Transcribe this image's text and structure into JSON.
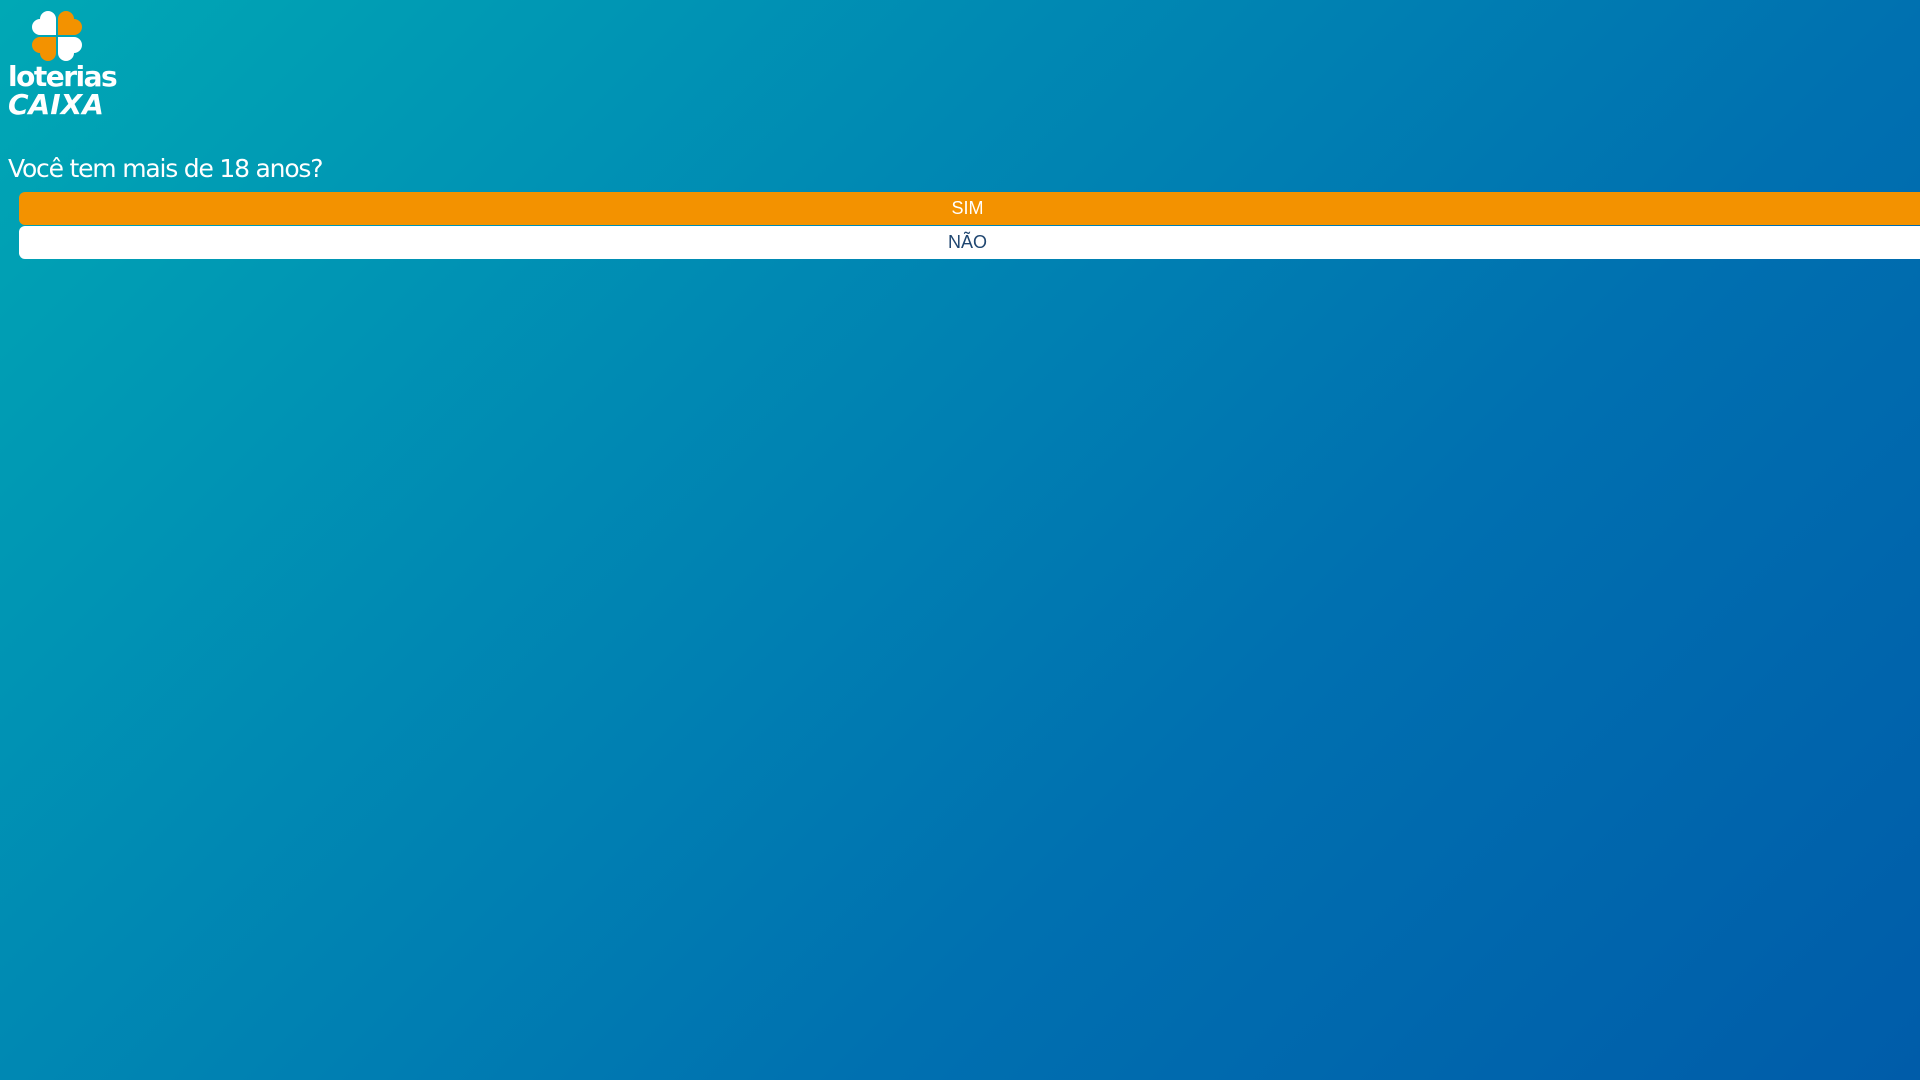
{
  "logo": {
    "line1": "loterias",
    "line2": "CAIXA",
    "colors": {
      "orange": "#f39200",
      "white": "#ffffff"
    }
  },
  "question": "Você tem mais de 18 anos?",
  "buttons": {
    "yes_label": "SIM",
    "no_label": "NÃO"
  },
  "colors": {
    "background_start": "#00a8b5",
    "background_end": "#005ca9",
    "accent": "#f39200",
    "no_text": "#1f4670"
  }
}
